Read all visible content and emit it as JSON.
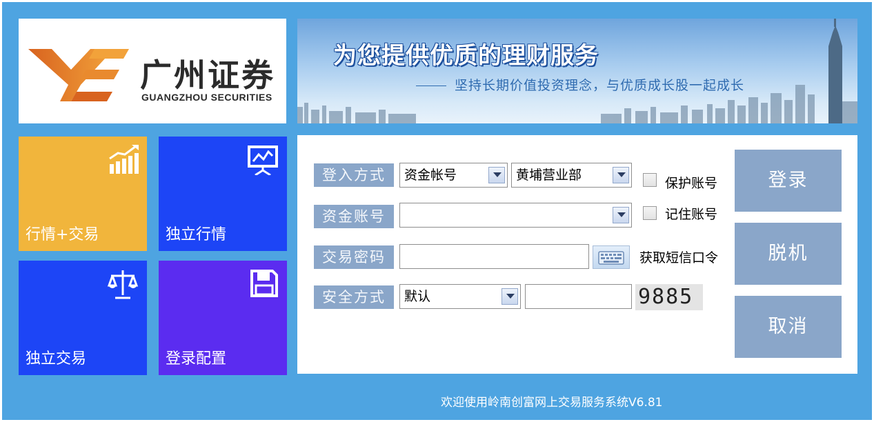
{
  "brand": {
    "name_cn": "广州证券",
    "name_en": "GUANGZHOU SECURITIES"
  },
  "banner": {
    "title": "为您提供优质的理财服务",
    "subtitle": "坚持长期价值投资理念，与优质成长股一起成长"
  },
  "tiles": [
    {
      "label": "行情+交易",
      "icon": "bar-chart-icon",
      "color": "#f1b53c"
    },
    {
      "label": "独立行情",
      "icon": "presentation-chart-icon",
      "color": "#1d45f6"
    },
    {
      "label": "独立交易",
      "icon": "scales-icon",
      "color": "#1d45f6"
    },
    {
      "label": "登录配置",
      "icon": "floppy-disk-icon",
      "color": "#5b2cf0"
    }
  ],
  "form": {
    "login_method": {
      "label": "登入方式",
      "value": "资金帐号",
      "branch": "黄埔营业部"
    },
    "account": {
      "label": "资金账号",
      "value": ""
    },
    "password": {
      "label": "交易密码",
      "value": "",
      "sms_link": "获取短信口令"
    },
    "security": {
      "label": "安全方式",
      "value": "默认",
      "code_input": "",
      "captcha": "9885"
    },
    "protect_account": {
      "label": "保护账号",
      "checked": false
    },
    "remember_account": {
      "label": "记住账号",
      "checked": false
    }
  },
  "buttons": {
    "login": "登录",
    "offline": "脱机",
    "cancel": "取消"
  },
  "footer": "欢迎使用岭南创富网上交易服务系统V6.81",
  "colors": {
    "window_bg": "#4ea4e1",
    "field_label_bg": "#8aa6c9",
    "button_bg": "#8aa6c9"
  }
}
